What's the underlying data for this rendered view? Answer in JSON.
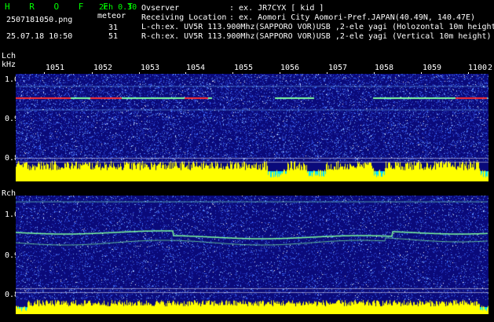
{
  "app": {
    "title": "H R O F F T",
    "filename": "2507181050.png",
    "datetime": "25.07.18 10:50",
    "mode": "2ch 0.30",
    "meteor_label": "meteor",
    "meteor_l": "31",
    "meteor_r": "51"
  },
  "info": {
    "observer_label": "Ovserver",
    "observer_value": ": ex. JR7CYX [ kid ]",
    "location_label": "Receiving Location",
    "location_value": ": ex. Aomori City Aomori-Pref.JAPAN(40.49N, 140.47E)",
    "lch_line": "L-ch:ex. UV5R 113.900Mhz(SAPPORO VOR)USB ,2-ele yagi (Holozontal 10m height",
    "rch_line": "R-ch:ex. UV5R 113.900Mhz(SAPPORO VOR)USB ,2-ele yagi (Vertical 10m height)"
  },
  "axis": {
    "lch_label": "Lch",
    "khz_label": "kHz",
    "rch_label": "Rch",
    "time_ticks": [
      "1051",
      "1052",
      "1053",
      "1054",
      "1055",
      "1056",
      "1057",
      "1058",
      "1059",
      "1100"
    ],
    "edge_tick": "2",
    "lch_freq_ticks": [
      "1.0",
      "0.9",
      "0.8"
    ],
    "rch_freq_ticks": [
      "1.0",
      "0.9",
      "0.8"
    ]
  },
  "colors": {
    "background": "#000000",
    "spectrum_low": "#0a0a7a",
    "noise": "#3c6cff",
    "signal_line": "#7fff9f",
    "hot_signal": "#ff3030",
    "meteor_bar": "#ffff00",
    "cyan_bar": "#00e0ff",
    "label_green": "#00ff00"
  }
}
